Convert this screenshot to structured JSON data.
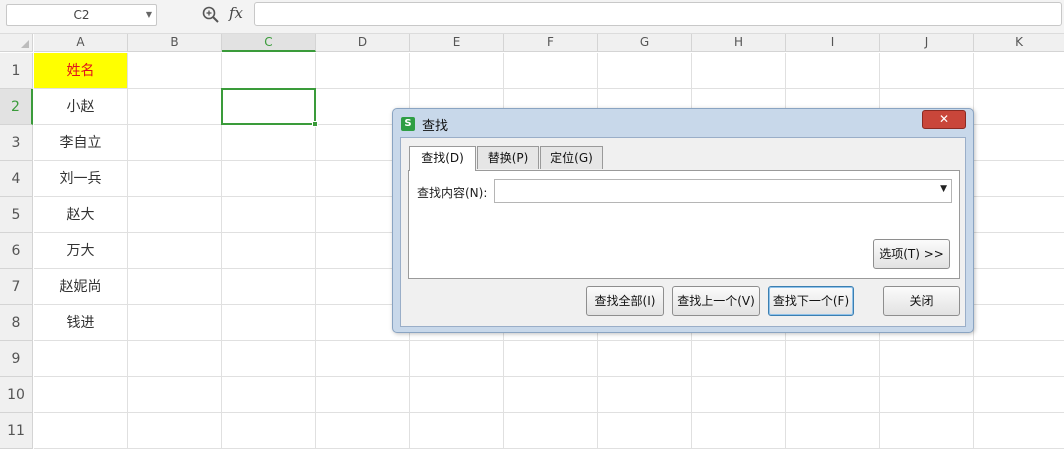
{
  "formula_bar": {
    "cell_reference": "C2",
    "fx_label": "fx",
    "formula_value": ""
  },
  "grid": {
    "columns": [
      "A",
      "B",
      "C",
      "D",
      "E",
      "F",
      "G",
      "H",
      "I",
      "J",
      "K"
    ],
    "rows": [
      "1",
      "2",
      "3",
      "4",
      "5",
      "6",
      "7",
      "8",
      "9",
      "10",
      "11"
    ],
    "active_column": "C",
    "active_row": "2",
    "column_a_cells": [
      "姓名",
      "小赵",
      "李自立",
      "刘一兵",
      "赵大",
      "万大",
      "赵妮尚",
      "钱进"
    ],
    "header_fill_color": "#ffff00",
    "header_text_color": "#e0101a",
    "selection_color": "#3a9b3a"
  },
  "dialog": {
    "title": "查找",
    "logo_letter": "S",
    "close_glyph": "✕",
    "tabs": [
      {
        "label": "查找(D)",
        "active": true
      },
      {
        "label": "替换(P)",
        "active": false
      },
      {
        "label": "定位(G)",
        "active": false
      }
    ],
    "find_label": "查找内容(N):",
    "find_value": "",
    "options_button": "选项(T) >>",
    "buttons": {
      "find_all": "查找全部(I)",
      "find_prev": "查找上一个(V)",
      "find_next": "查找下一个(F)",
      "close": "关闭"
    }
  }
}
